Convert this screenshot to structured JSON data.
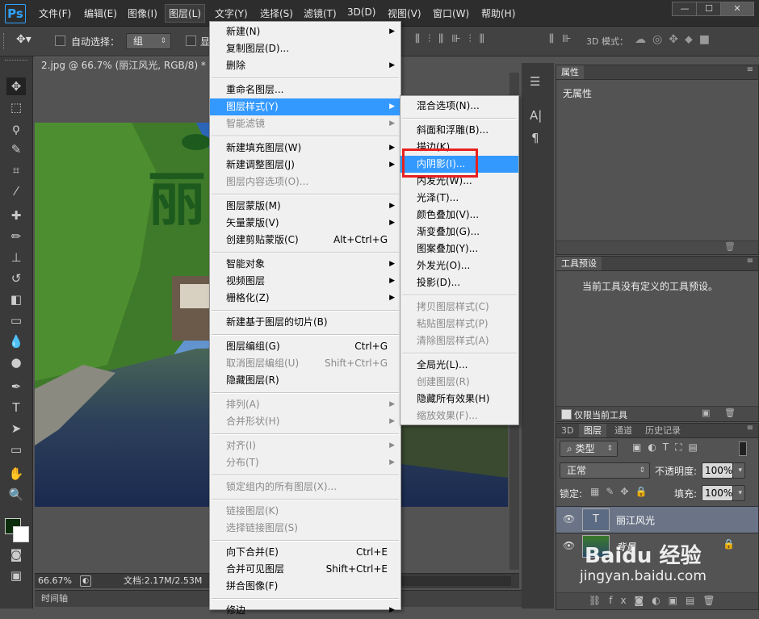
{
  "menubar": {
    "logo": "Ps",
    "items": [
      "文件(F)",
      "编辑(E)",
      "图像(I)",
      "图层(L)",
      "文字(Y)",
      "选择(S)",
      "滤镜(T)",
      "3D(D)",
      "视图(V)",
      "窗口(W)",
      "帮助(H)"
    ],
    "win_buttons": [
      "—",
      "☐",
      "✕"
    ]
  },
  "options": {
    "auto_select_label": "自动选择：",
    "auto_select_value": "组",
    "show_label": "显",
    "mode3d_label": "3D 模式："
  },
  "document": {
    "tab_title": "2.jpg @ 66.7% (丽江风光, RGB/8) *",
    "tab_close": "×",
    "zoom": "66.67%",
    "doc_size": "文档:2.17M/2.53M",
    "timeline": "时间轴"
  },
  "panels": {
    "properties_tab": "属性",
    "properties_empty": "无属性",
    "presets_tab": "工具预设",
    "presets_empty": "当前工具没有定义的工具预设。",
    "presets_checkbox": "仅限当前工具",
    "layers_tabs": [
      "3D",
      "图层",
      "通道",
      "历史记录"
    ],
    "filter_label": "类型",
    "blend_mode": "正常",
    "opacity_label": "不透明度:",
    "opacity_value": "100%",
    "lock_label": "锁定:",
    "fill_label": "填充:",
    "fill_value": "100%",
    "layers": [
      {
        "name": "丽江风光",
        "type": "text"
      },
      {
        "name": "背景",
        "type": "image"
      }
    ]
  },
  "watermark": {
    "brand": "Baidu 经验",
    "url": "jingyan.baidu.com"
  },
  "layer_menu": {
    "items": [
      {
        "label": "新建(N)",
        "sub": true
      },
      {
        "label": "复制图层(D)..."
      },
      {
        "label": "删除",
        "sub": true
      },
      {
        "sep": true
      },
      {
        "label": "重命名图层..."
      },
      {
        "label": "图层样式(Y)",
        "sub": true,
        "highlight": true
      },
      {
        "label": "智能滤镜",
        "sub": true,
        "disabled": true
      },
      {
        "sep": true
      },
      {
        "label": "新建填充图层(W)",
        "sub": true
      },
      {
        "label": "新建调整图层(J)",
        "sub": true
      },
      {
        "label": "图层内容选项(O)...",
        "disabled": true
      },
      {
        "sep": true
      },
      {
        "label": "图层蒙版(M)",
        "sub": true
      },
      {
        "label": "矢量蒙版(V)",
        "sub": true
      },
      {
        "label": "创建剪贴蒙版(C)",
        "shortcut": "Alt+Ctrl+G"
      },
      {
        "sep": true
      },
      {
        "label": "智能对象",
        "sub": true
      },
      {
        "label": "视频图层",
        "sub": true
      },
      {
        "label": "栅格化(Z)",
        "sub": true
      },
      {
        "sep": true
      },
      {
        "label": "新建基于图层的切片(B)"
      },
      {
        "sep": true
      },
      {
        "label": "图层编组(G)",
        "shortcut": "Ctrl+G"
      },
      {
        "label": "取消图层编组(U)",
        "shortcut": "Shift+Ctrl+G",
        "disabled": true
      },
      {
        "label": "隐藏图层(R)"
      },
      {
        "sep": true
      },
      {
        "label": "排列(A)",
        "sub": true,
        "disabled": true
      },
      {
        "label": "合并形状(H)",
        "sub": true,
        "disabled": true
      },
      {
        "sep": true
      },
      {
        "label": "对齐(I)",
        "sub": true,
        "disabled": true
      },
      {
        "label": "分布(T)",
        "sub": true,
        "disabled": true
      },
      {
        "sep": true
      },
      {
        "label": "锁定组内的所有图层(X)...",
        "disabled": true
      },
      {
        "sep": true
      },
      {
        "label": "链接图层(K)",
        "disabled": true
      },
      {
        "label": "选择链接图层(S)",
        "disabled": true
      },
      {
        "sep": true
      },
      {
        "label": "向下合并(E)",
        "shortcut": "Ctrl+E"
      },
      {
        "label": "合并可见图层",
        "shortcut": "Shift+Ctrl+E"
      },
      {
        "label": "拼合图像(F)"
      },
      {
        "sep": true
      },
      {
        "label": "修边",
        "sub": true
      }
    ]
  },
  "style_menu": {
    "items": [
      {
        "label": "混合选项(N)..."
      },
      {
        "sep": true
      },
      {
        "label": "斜面和浮雕(B)..."
      },
      {
        "label": "描边(K)..."
      },
      {
        "label": "内阴影(I)...",
        "highlight": true
      },
      {
        "label": "内发光(W)..."
      },
      {
        "label": "光泽(T)..."
      },
      {
        "label": "颜色叠加(V)..."
      },
      {
        "label": "渐变叠加(G)..."
      },
      {
        "label": "图案叠加(Y)..."
      },
      {
        "label": "外发光(O)..."
      },
      {
        "label": "投影(D)..."
      },
      {
        "sep": true
      },
      {
        "label": "拷贝图层样式(C)",
        "disabled": true
      },
      {
        "label": "粘贴图层样式(P)",
        "disabled": true
      },
      {
        "label": "清除图层样式(A)",
        "disabled": true
      },
      {
        "sep": true
      },
      {
        "label": "全局光(L)..."
      },
      {
        "label": "创建图层(R)",
        "disabled": true
      },
      {
        "label": "隐藏所有效果(H)"
      },
      {
        "label": "缩放效果(F)...",
        "disabled": true
      }
    ]
  }
}
